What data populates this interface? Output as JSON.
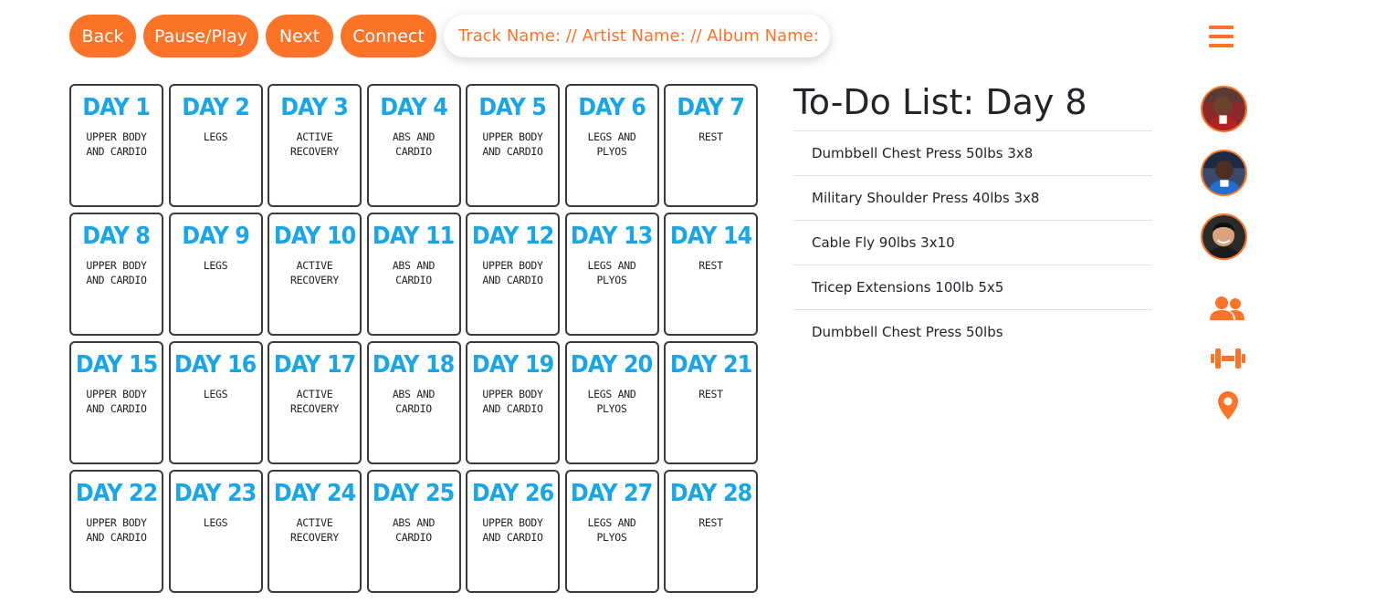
{
  "controls": {
    "back": "Back",
    "pause_play": "Pause/Play",
    "next": "Next",
    "connect": "Connect",
    "track_info": "Track Name: // Artist Name: // Album Name:"
  },
  "calendar": [
    {
      "day": "DAY 1",
      "sub": "UPPER BODY AND CARDIO"
    },
    {
      "day": "DAY 2",
      "sub": "LEGS"
    },
    {
      "day": "DAY 3",
      "sub": "ACTIVE RECOVERY"
    },
    {
      "day": "DAY 4",
      "sub": "ABS AND CARDIO"
    },
    {
      "day": "DAY 5",
      "sub": "UPPER BODY AND CARDIO"
    },
    {
      "day": "DAY 6",
      "sub": "LEGS AND PLYOS"
    },
    {
      "day": "DAY 7",
      "sub": "REST"
    },
    {
      "day": "DAY 8",
      "sub": "UPPER BODY AND CARDIO"
    },
    {
      "day": "DAY 9",
      "sub": "LEGS"
    },
    {
      "day": "DAY 10",
      "sub": "ACTIVE RECOVERY"
    },
    {
      "day": "DAY 11",
      "sub": "ABS AND CARDIO"
    },
    {
      "day": "DAY 12",
      "sub": "UPPER BODY AND CARDIO"
    },
    {
      "day": "DAY 13",
      "sub": "LEGS AND PLYOS"
    },
    {
      "day": "DAY 14",
      "sub": "REST"
    },
    {
      "day": "DAY 15",
      "sub": "UPPER BODY AND CARDIO"
    },
    {
      "day": "DAY 16",
      "sub": "LEGS"
    },
    {
      "day": "DAY 17",
      "sub": "ACTIVE RECOVERY"
    },
    {
      "day": "DAY 18",
      "sub": "ABS AND CARDIO"
    },
    {
      "day": "DAY 19",
      "sub": "UPPER BODY AND CARDIO"
    },
    {
      "day": "DAY 20",
      "sub": "LEGS AND PLYOS"
    },
    {
      "day": "DAY 21",
      "sub": "REST"
    },
    {
      "day": "DAY 22",
      "sub": "UPPER BODY AND CARDIO"
    },
    {
      "day": "DAY 23",
      "sub": "LEGS"
    },
    {
      "day": "DAY 24",
      "sub": "ACTIVE RECOVERY"
    },
    {
      "day": "DAY 25",
      "sub": "ABS AND CARDIO"
    },
    {
      "day": "DAY 26",
      "sub": "UPPER BODY AND CARDIO"
    },
    {
      "day": "DAY 27",
      "sub": "LEGS AND PLYOS"
    },
    {
      "day": "DAY 28",
      "sub": "REST"
    }
  ],
  "todo": {
    "title": "To-Do List: Day 8",
    "items": [
      "Dumbbell Chest Press 50lbs 3x8",
      "Military Shoulder Press 40lbs 3x8",
      "Cable Fly 90lbs 3x10",
      "Tricep Extensions 100lb 5x5",
      "Dumbbell Chest Press 50lbs"
    ]
  },
  "sidebar": {
    "icons": [
      "hamburger-menu-icon",
      "users-icon",
      "dumbbell-icon",
      "map-pin-icon"
    ]
  },
  "colors": {
    "accent": "#fd7328",
    "day_title": "#1aa6e6"
  }
}
